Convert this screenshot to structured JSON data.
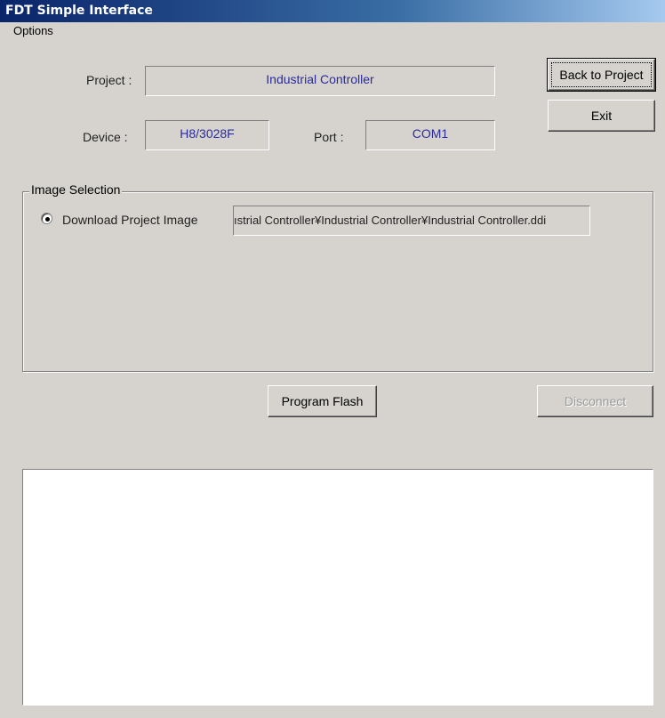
{
  "window": {
    "title": "FDT Simple Interface"
  },
  "menu": {
    "options_label": "Options"
  },
  "project": {
    "label": "Project :",
    "value": "Industrial Controller"
  },
  "device": {
    "label": "Device :",
    "value": "H8/3028F"
  },
  "port": {
    "label": "Port :",
    "value": "COM1"
  },
  "buttons": {
    "back_to_project": "Back to Project",
    "exit": "Exit",
    "program_flash": "Program Flash",
    "disconnect": "Disconnect"
  },
  "image_selection": {
    "legend": "Image Selection",
    "radio_label": "Download Project Image",
    "radio_selected": true,
    "path_display": "ıstrial Controller¥Industrial Controller¥Industrial Controller.ddi"
  },
  "log": {
    "content": ""
  }
}
